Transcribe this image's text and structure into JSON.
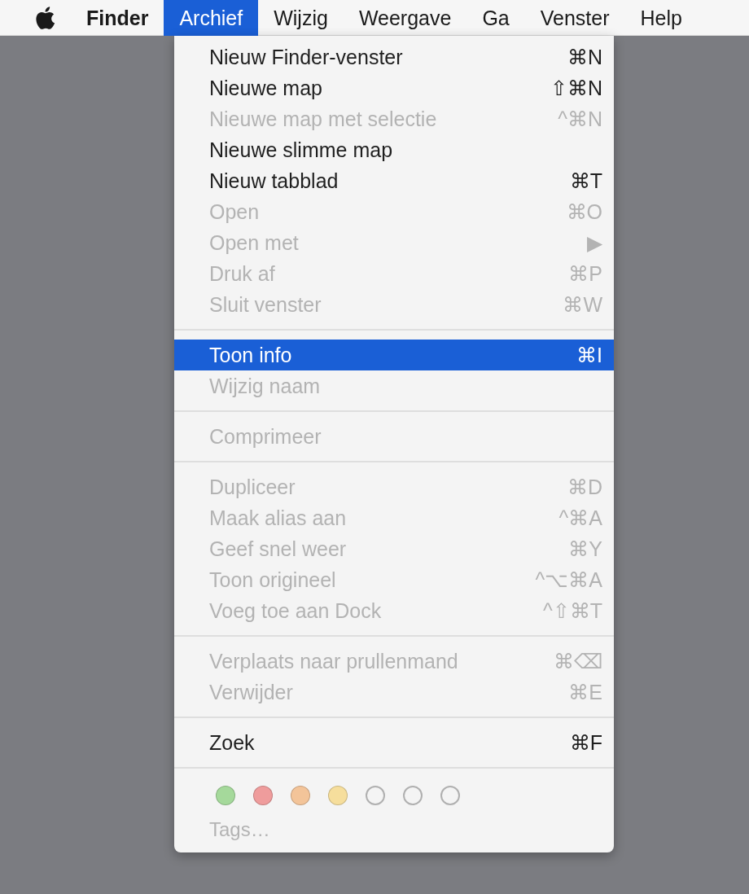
{
  "menubar": {
    "items": [
      {
        "label": "Finder",
        "kind": "app",
        "selected": false
      },
      {
        "label": "Archief",
        "kind": "menu",
        "selected": true
      },
      {
        "label": "Wijzig",
        "kind": "menu",
        "selected": false
      },
      {
        "label": "Weergave",
        "kind": "menu",
        "selected": false
      },
      {
        "label": "Ga",
        "kind": "menu",
        "selected": false
      },
      {
        "label": "Venster",
        "kind": "menu",
        "selected": false
      },
      {
        "label": "Help",
        "kind": "menu",
        "selected": false
      }
    ]
  },
  "menu": {
    "sections": [
      {
        "items": [
          {
            "label": "Nieuw Finder-venster",
            "shortcut": "⌘N",
            "disabled": false,
            "selected": false
          },
          {
            "label": "Nieuwe map",
            "shortcut": "⇧⌘N",
            "disabled": false,
            "selected": false
          },
          {
            "label": "Nieuwe map met selectie",
            "shortcut": "^⌘N",
            "disabled": true,
            "selected": false
          },
          {
            "label": "Nieuwe slimme map",
            "disabled": false,
            "selected": false
          },
          {
            "label": "Nieuw tabblad",
            "shortcut": "⌘T",
            "disabled": false,
            "selected": false
          },
          {
            "label": "Open",
            "shortcut": "⌘O",
            "disabled": true,
            "selected": false
          },
          {
            "label": "Open met",
            "shortcut": "▶",
            "disabled": true,
            "selected": false
          },
          {
            "label": "Druk af",
            "shortcut": "⌘P",
            "disabled": true,
            "selected": false
          },
          {
            "label": "Sluit venster",
            "shortcut": "⌘W",
            "disabled": true,
            "selected": false
          }
        ]
      },
      {
        "items": [
          {
            "label": "Toon info",
            "shortcut": "⌘I",
            "disabled": false,
            "selected": true
          },
          {
            "label": "Wijzig naam",
            "disabled": true,
            "selected": false
          }
        ]
      },
      {
        "items": [
          {
            "label": "Comprimeer",
            "disabled": true,
            "selected": false
          }
        ]
      },
      {
        "items": [
          {
            "label": "Dupliceer",
            "shortcut": "⌘D",
            "disabled": true,
            "selected": false
          },
          {
            "label": "Maak alias aan",
            "shortcut": "^⌘A",
            "disabled": true,
            "selected": false
          },
          {
            "label": "Geef snel weer",
            "shortcut": "⌘Y",
            "disabled": true,
            "selected": false
          },
          {
            "label": "Toon origineel",
            "shortcut": "^⌥⌘A",
            "disabled": true,
            "selected": false
          },
          {
            "label": "Voeg toe aan Dock",
            "shortcut": "^⇧⌘T",
            "disabled": true,
            "selected": false
          }
        ]
      },
      {
        "items": [
          {
            "label": "Verplaats naar prullenmand",
            "shortcut": "⌘⌫",
            "disabled": true,
            "selected": false
          },
          {
            "label": "Verwijder",
            "shortcut": "⌘E",
            "disabled": true,
            "selected": false
          }
        ]
      },
      {
        "items": [
          {
            "label": "Zoek",
            "shortcut": "⌘F",
            "disabled": false,
            "selected": false
          }
        ]
      }
    ],
    "tags": [
      {
        "kind": "filled",
        "color": "#a5d99b"
      },
      {
        "kind": "filled",
        "color": "#ef9c9c"
      },
      {
        "kind": "filled",
        "color": "#f3c499"
      },
      {
        "kind": "filled",
        "color": "#f6de9c"
      },
      {
        "kind": "empty"
      },
      {
        "kind": "empty"
      },
      {
        "kind": "empty"
      }
    ],
    "tags_label": {
      "label": "Tags…",
      "disabled": true
    }
  }
}
